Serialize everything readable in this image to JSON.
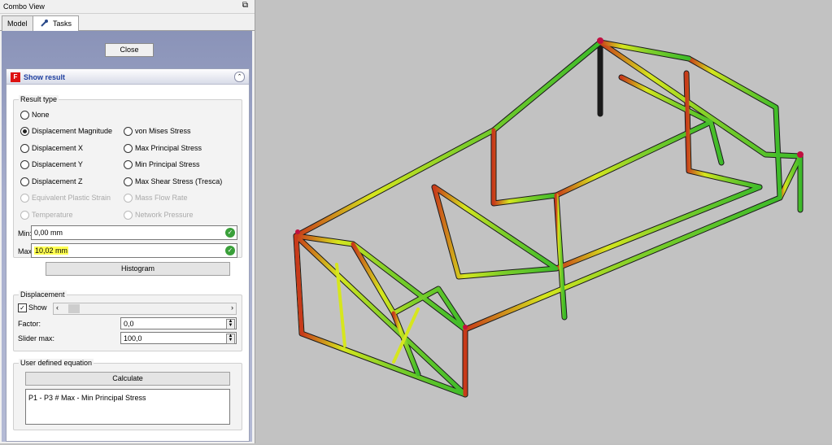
{
  "window": {
    "title": "Combo View"
  },
  "tabs": {
    "model": "Model",
    "tasks": "Tasks"
  },
  "task": {
    "close_label": "Close",
    "panel_title": "Show result",
    "result_type": {
      "group_title": "Result type",
      "options": {
        "none": "None",
        "disp_mag": "Displacement Magnitude",
        "disp_x": "Displacement X",
        "disp_y": "Displacement Y",
        "disp_z": "Displacement Z",
        "eq_plastic": "Equivalent Plastic Strain",
        "temperature": "Temperature",
        "von_mises": "von Mises Stress",
        "max_principal": "Max Principal Stress",
        "min_principal": "Min Principal Stress",
        "max_shear": "Max Shear Stress (Tresca)",
        "mass_flow": "Mass Flow Rate",
        "net_pressure": "Network Pressure"
      },
      "selected": "Displacement Magnitude"
    },
    "min_label": "Min:",
    "min_value": "0,00 mm",
    "max_label": "Max:",
    "max_value": "10,02 mm",
    "histogram_label": "Histogram",
    "displacement": {
      "group_title": "Displacement",
      "show_label": "Show",
      "show_checked": true,
      "factor_label": "Factor:",
      "factor_value": "0,0",
      "slider_max_label": "Slider max:",
      "slider_max_value": "100,0"
    },
    "equation": {
      "group_title": "User defined equation",
      "calculate_label": "Calculate",
      "text": "P1 - P3 # Max - Min Principal Stress"
    }
  },
  "colors": {
    "beam_green": "#3dbb2a",
    "beam_yellow": "#d6e61e",
    "beam_red": "#c83a1a",
    "viewport_bg": "#c2c2c2"
  },
  "icons": [
    "wrench-icon",
    "fem-logo-icon",
    "collapse-icon",
    "checkmark-icon",
    "spin-arrows-icon",
    "slider-arrow-icon"
  ]
}
